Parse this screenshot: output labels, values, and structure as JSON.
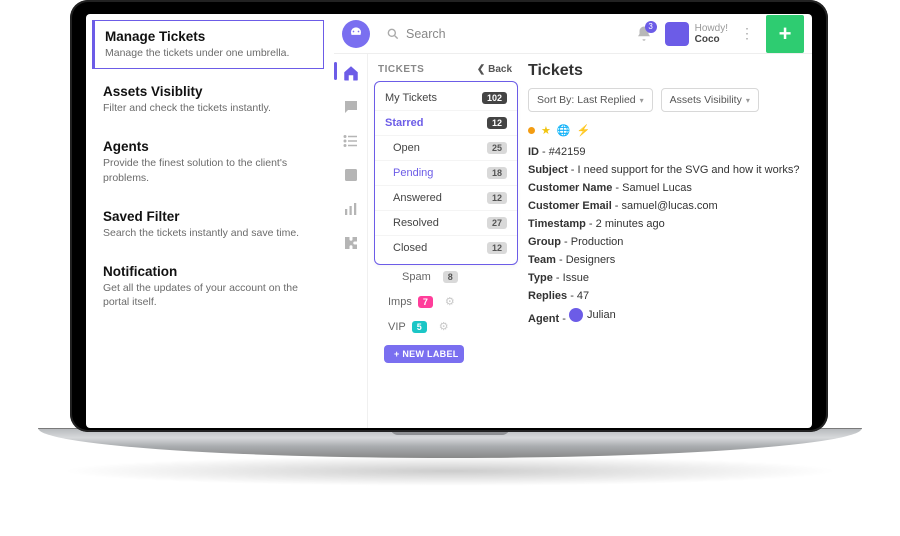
{
  "marketing": {
    "items": [
      {
        "title": "Manage Tickets",
        "desc": "Manage the tickets under one umbrella."
      },
      {
        "title": "Assets Visiblity",
        "desc": "Filter and check the tickets instantly."
      },
      {
        "title": "Agents",
        "desc": "Provide the finest solution to the client's problems."
      },
      {
        "title": "Saved Filter",
        "desc": "Search the tickets instantly and save time."
      },
      {
        "title": "Notification",
        "desc": "Get all the updates of your account on the portal itself."
      }
    ]
  },
  "topbar": {
    "search_placeholder": "Search",
    "notif_count": "3",
    "greeting": "Howdy!",
    "username": "Coco"
  },
  "rail": {
    "icons": [
      "home-icon",
      "chat-icon",
      "list-icon",
      "card-icon",
      "bars-icon",
      "puzzle-icon"
    ]
  },
  "ticket_nav": {
    "header": "TICKETS",
    "back": "Back",
    "rows": [
      {
        "label": "My Tickets",
        "count": "102",
        "style": "dark"
      },
      {
        "label": "Starred",
        "count": "12",
        "style": "dark",
        "variant": "starred"
      },
      {
        "label": "Open",
        "count": "25",
        "style": "light"
      },
      {
        "label": "Pending",
        "count": "18",
        "style": "light",
        "variant": "pending"
      },
      {
        "label": "Answered",
        "count": "12",
        "style": "light"
      },
      {
        "label": "Resolved",
        "count": "27",
        "style": "light"
      },
      {
        "label": "Closed",
        "count": "12",
        "style": "light"
      }
    ],
    "extras": [
      {
        "label": "Spam",
        "count": "8",
        "style": "light"
      },
      {
        "label": "Imps",
        "count": "7",
        "style": "pink",
        "gear": true
      },
      {
        "label": "VIP",
        "count": "5",
        "style": "teal",
        "gear": true
      }
    ],
    "new_label_btn": "+ NEW LABEL"
  },
  "content": {
    "heading": "Tickets",
    "sort_label": "Sort By: Last Replied",
    "visibility_label": "Assets Visibility",
    "ticket": {
      "id_label": "ID",
      "id": "#42159",
      "subject_label": "Subject",
      "subject": "I need support for the SVG and how it works?",
      "cust_name_label": "Customer Name",
      "cust_name": "Samuel Lucas",
      "cust_email_label": "Customer Email",
      "cust_email": "samuel@lucas.com",
      "ts_label": "Timestamp",
      "ts": "2 minutes ago",
      "group_label": "Group",
      "group": "Production",
      "team_label": "Team",
      "team": "Designers",
      "type_label": "Type",
      "type": "Issue",
      "replies_label": "Replies",
      "replies": "47",
      "agent_label": "Agent",
      "agent": "Julian"
    }
  }
}
